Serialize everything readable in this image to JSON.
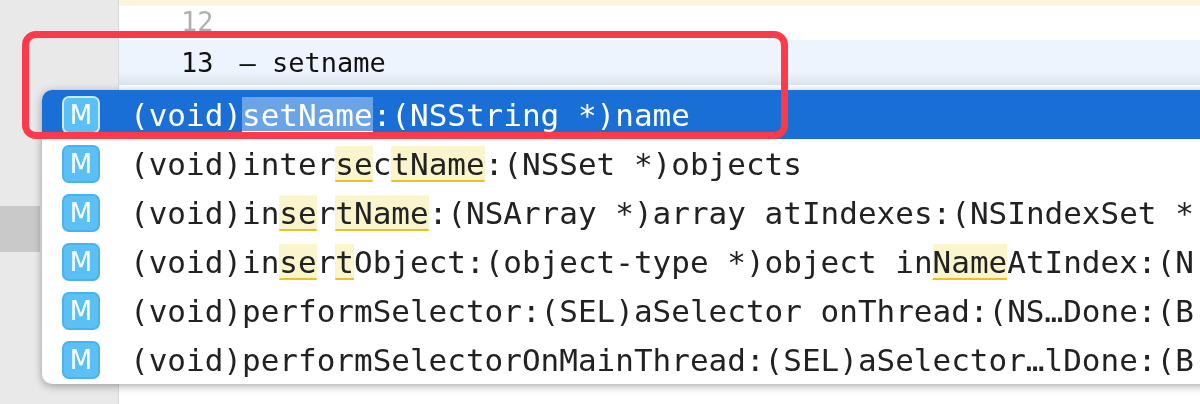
{
  "editor": {
    "lines": [
      {
        "number": "12",
        "current": false
      },
      {
        "number": "13",
        "code": "– setname",
        "current": true
      }
    ]
  },
  "completions": [
    {
      "icon": "M",
      "selected": true,
      "segments": [
        {
          "text": "(void)",
          "match": false
        },
        {
          "text": "setName",
          "match": true
        },
        {
          "text": ":(NSString *)name",
          "match": false
        }
      ]
    },
    {
      "icon": "M",
      "selected": false,
      "segments": [
        {
          "text": "(void)inter",
          "match": false
        },
        {
          "text": "se",
          "match": true
        },
        {
          "text": "c",
          "match": false
        },
        {
          "text": "tName",
          "match": true
        },
        {
          "text": ":(NSSet *)objects",
          "match": false
        }
      ]
    },
    {
      "icon": "M",
      "selected": false,
      "segments": [
        {
          "text": "(void)in",
          "match": false
        },
        {
          "text": "se",
          "match": true
        },
        {
          "text": "r",
          "match": false
        },
        {
          "text": "tName",
          "match": true
        },
        {
          "text": ":(NSArray *)array atIndexes:(NSIndexSet *",
          "match": false
        }
      ]
    },
    {
      "icon": "M",
      "selected": false,
      "segments": [
        {
          "text": "(void)in",
          "match": false
        },
        {
          "text": "se",
          "match": true
        },
        {
          "text": "r",
          "match": false
        },
        {
          "text": "t",
          "match": true
        },
        {
          "text": "Object:(object-type *)object in",
          "match": false
        },
        {
          "text": "Name",
          "match": true
        },
        {
          "text": "AtIndex:(N",
          "match": false
        }
      ]
    },
    {
      "icon": "M",
      "selected": false,
      "segments": [
        {
          "text": "(void)performSelector:(SEL)aSelector onThread:(NS…Done:(B",
          "match": false
        }
      ]
    },
    {
      "icon": "M",
      "selected": false,
      "segments": [
        {
          "text": "(void)performSelectorOnMainThread:(SEL)aSelector…lDone:(B",
          "match": false
        }
      ]
    }
  ]
}
